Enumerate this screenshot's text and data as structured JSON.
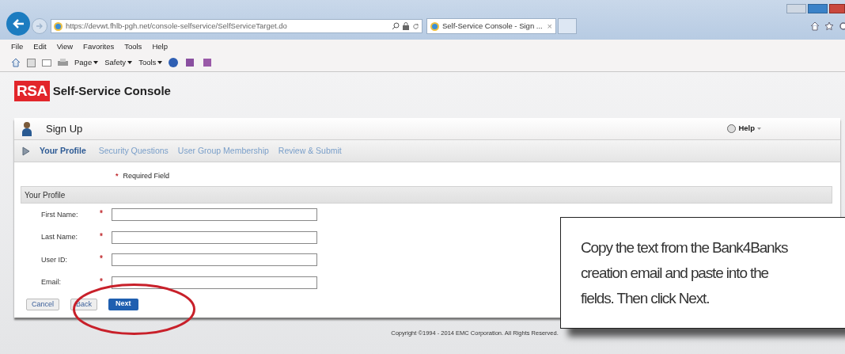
{
  "browser": {
    "address": "https://devwt.fhlb-pgh.net/console-selfservice/SelfServiceTarget.do",
    "tab_title": "Self-Service Console - Sign ...",
    "tab_close": "×",
    "menu": [
      "File",
      "Edit",
      "View",
      "Favorites",
      "Tools",
      "Help"
    ],
    "commands": [
      "Page",
      "Safety",
      "Tools"
    ]
  },
  "app": {
    "logo": "RSA",
    "title": "Self-Service Console"
  },
  "panel": {
    "title": "Sign Up",
    "help": "Help",
    "steps": [
      {
        "label": "Your Profile",
        "selected": true
      },
      {
        "label": "Security Questions",
        "selected": false
      },
      {
        "label": "User Group Membership",
        "selected": false
      },
      {
        "label": "Review & Submit",
        "selected": false
      }
    ],
    "required_note": "Required Field",
    "required_mark": "*",
    "section": "Your Profile",
    "fields": [
      {
        "label": "First Name:",
        "required": true
      },
      {
        "label": "Last Name:",
        "required": true
      },
      {
        "label": "User ID:",
        "required": true
      },
      {
        "label": "Email:",
        "required": true
      }
    ],
    "buttons": [
      {
        "label": "Cancel",
        "kind": "secondary"
      },
      {
        "label": "Back",
        "kind": "secondary"
      },
      {
        "label": "Next",
        "kind": "primary"
      }
    ]
  },
  "footer": "Copyright ©1994 - 2014 EMC Corporation. All Rights Reserved.",
  "callout": {
    "lines": [
      "Copy the text from the Bank4Banks",
      "creation email and paste into the",
      "fields. Then click Next."
    ]
  }
}
